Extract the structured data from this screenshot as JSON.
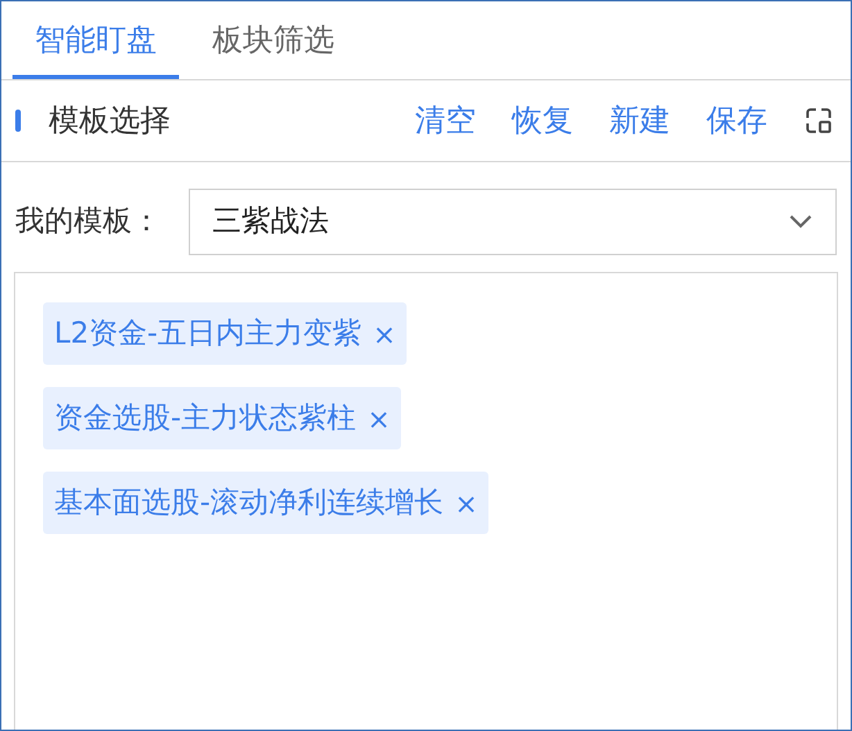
{
  "tabs": [
    {
      "label": "智能盯盘",
      "selected": true
    },
    {
      "label": "板块筛选",
      "selected": false
    }
  ],
  "section": {
    "title": "模板选择",
    "actions": [
      "清空",
      "恢复",
      "新建",
      "保存"
    ]
  },
  "template": {
    "label": "我的模板：",
    "value": "三紫战法"
  },
  "tags": [
    {
      "label": "L2资金-五日内主力变紫",
      "remove": "×"
    },
    {
      "label": "资金选股-主力状态紫柱",
      "remove": "×"
    },
    {
      "label": "基本面选股-滚动净利连续增长",
      "remove": "×"
    }
  ]
}
